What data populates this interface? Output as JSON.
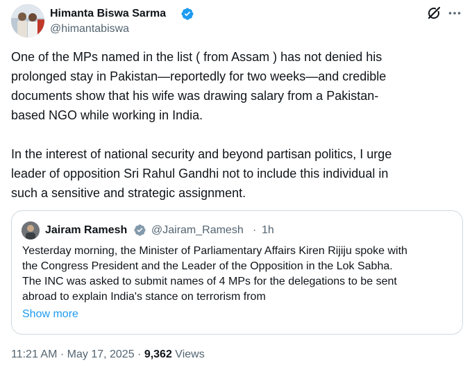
{
  "author": {
    "name": "Himanta Biswa Sarma",
    "handle": "@himantabiswa",
    "verified_color": "#1d9bf0"
  },
  "tweet": {
    "paragraph1_lines": [
      "One of the MPs named  in the list ( from Assam ) has not denied his",
      "prolonged stay in Pakistan—reportedly for two weeks—and credible",
      "documents show that his wife was drawing salary from a Pakistan-",
      "based NGO while working in India."
    ],
    "paragraph2_lines": [
      "In the interest of national security and beyond partisan politics, I urge",
      "leader of opposition Sri Rahul Gandhi not to include this individual in",
      "such a sensitive and strategic assignment."
    ]
  },
  "quoted_tweet": {
    "name": "Jairam Ramesh",
    "handle": "@Jairam_Ramesh",
    "separator": "·",
    "time": "1h",
    "lines": [
      "Yesterday morning, the Minister of Parliamentary Affairs Kiren Rijiju spoke with",
      "the Congress President and the Leader of the Opposition in the Lok Sabha.",
      "The INC was asked to submit names of 4 MPs for the delegations to be sent",
      "abroad to explain India's stance on terrorism from"
    ],
    "show_more": "Show more"
  },
  "meta": {
    "time": "11:21 AM",
    "sep1": " · ",
    "date": "May 17, 2025",
    "sep2": " · ",
    "views_count": "9,362",
    "views_label": " Views"
  },
  "icons": {
    "grok": "grok-icon",
    "more": "more-options-icon",
    "verified": "verified-badge-icon"
  }
}
